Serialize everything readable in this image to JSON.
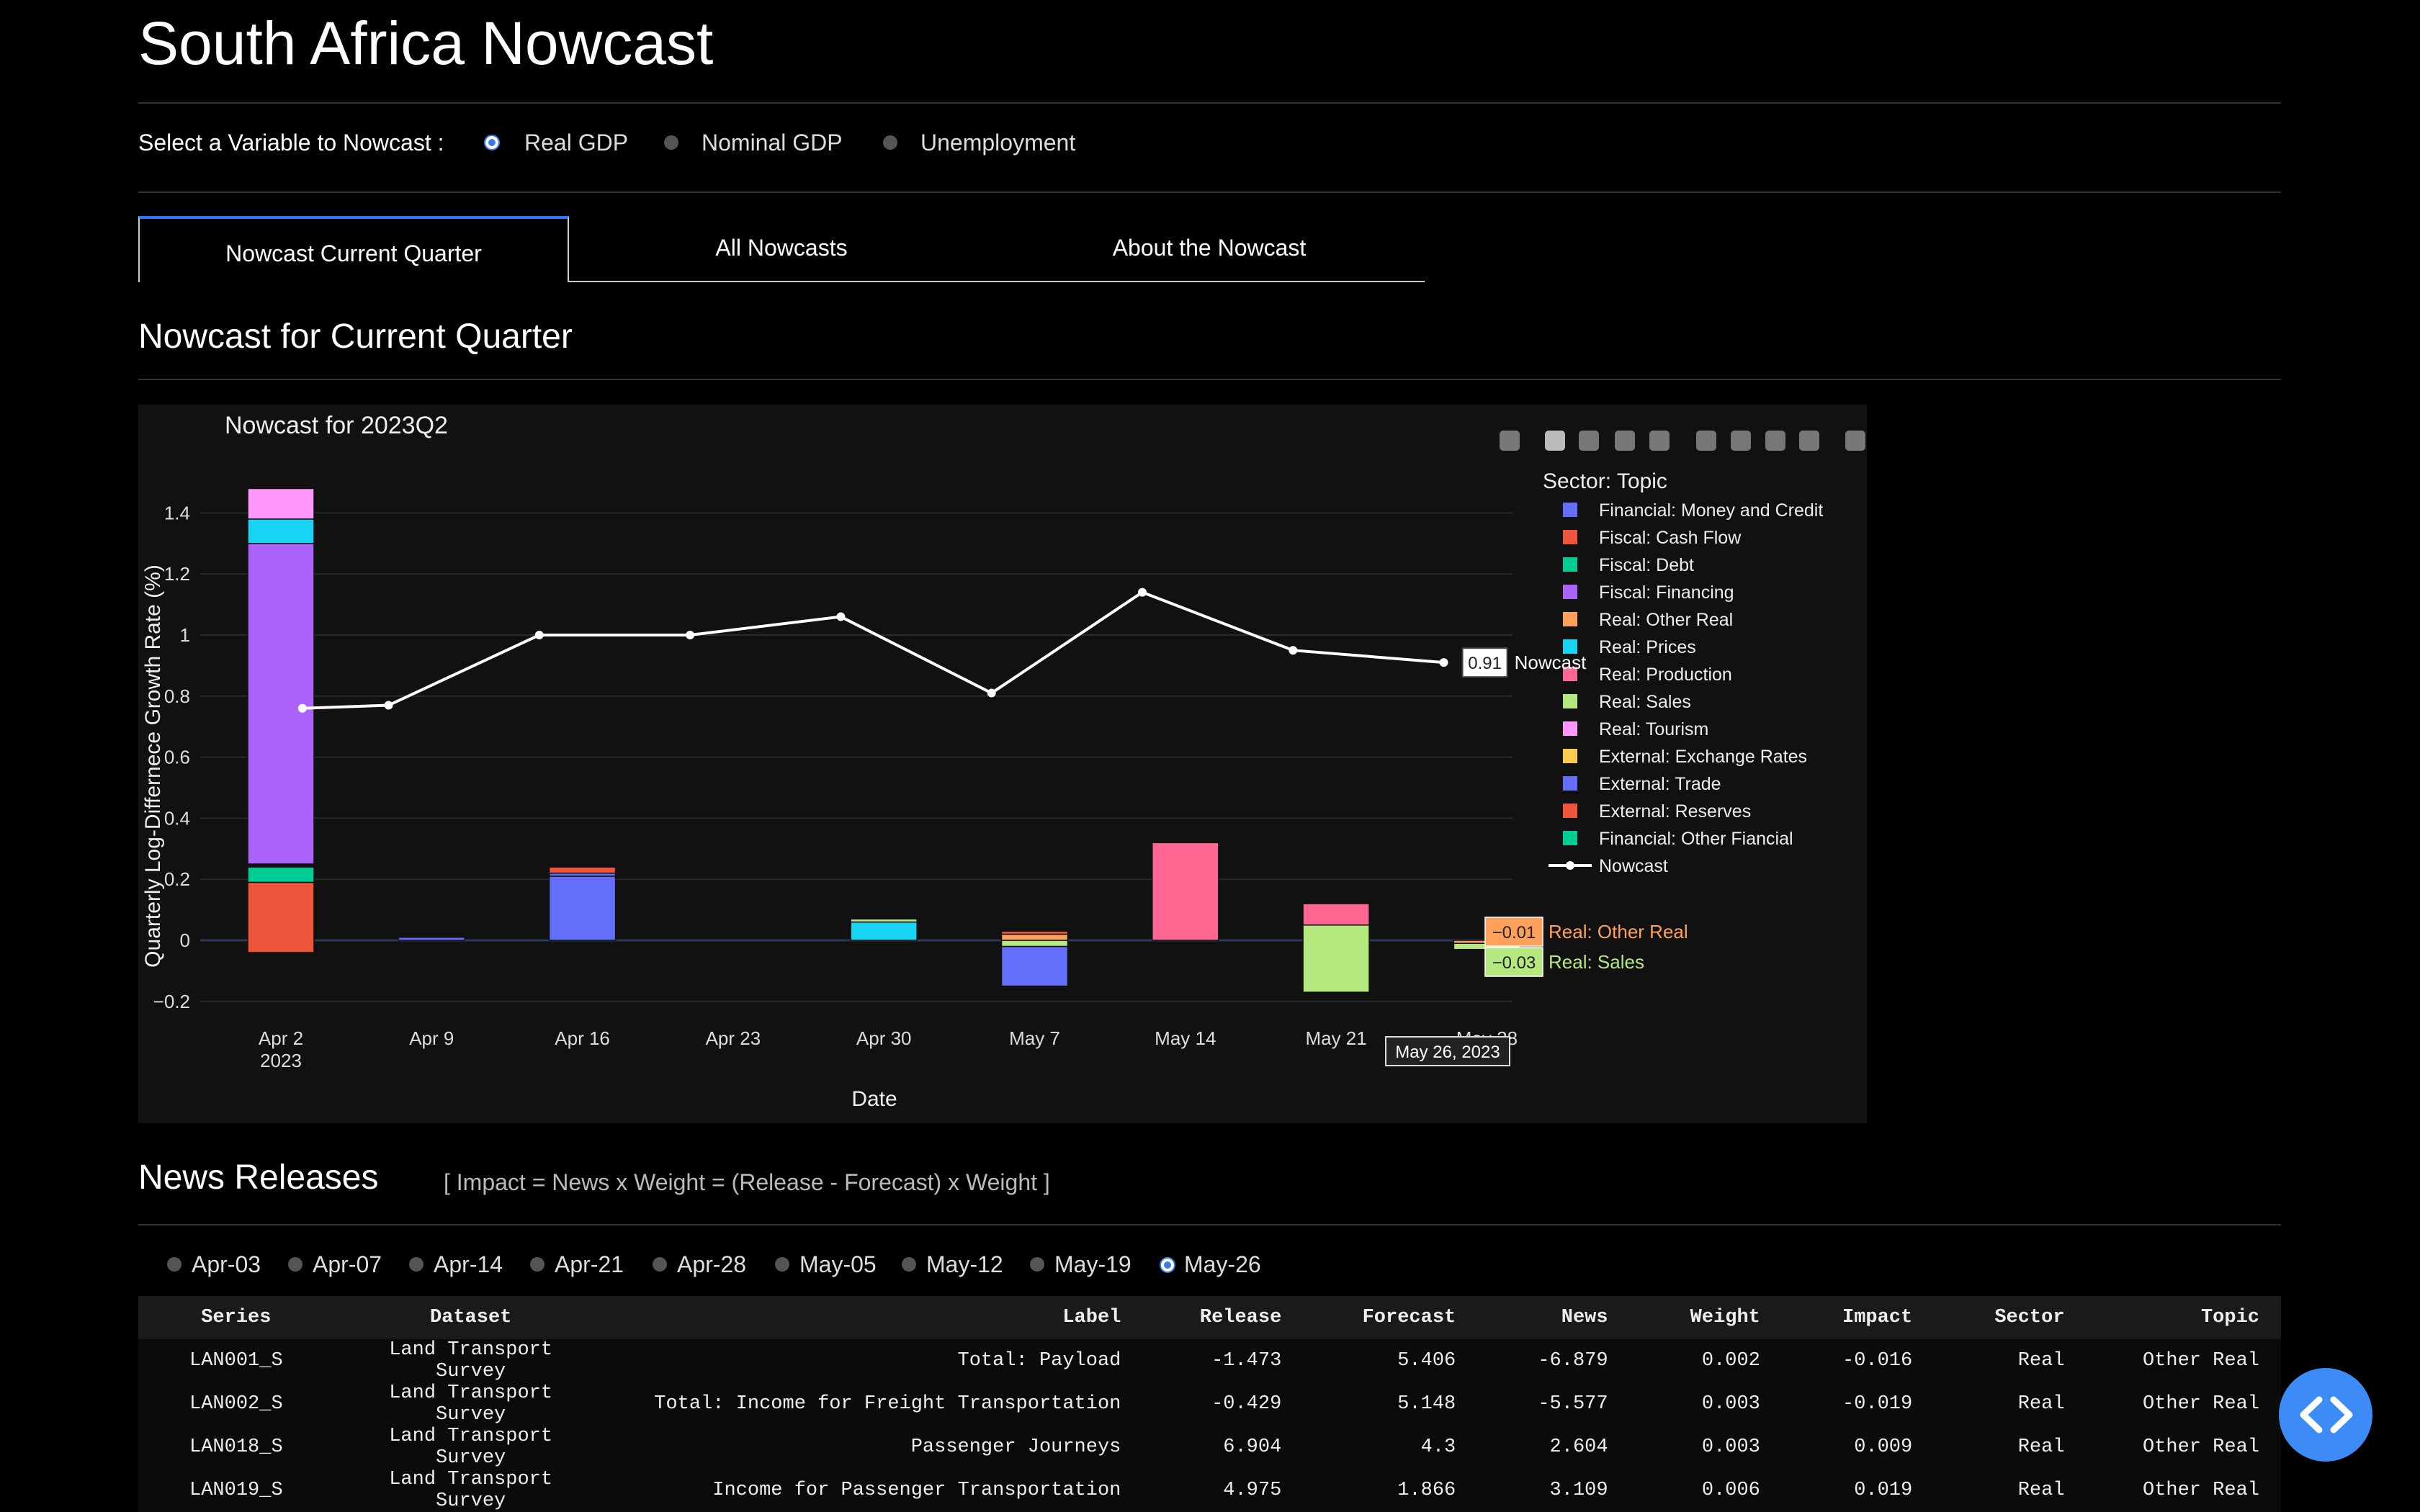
{
  "page_title": "South Africa Nowcast",
  "variable_label": "Select a Variable to Nowcast :",
  "variables": [
    "Real GDP",
    "Nominal GDP",
    "Unemployment"
  ],
  "tabs": [
    "Nowcast Current Quarter",
    "All Nowcasts",
    "About the Nowcast"
  ],
  "section_title": "Nowcast for Current Quarter",
  "chart_data": {
    "type": "bar",
    "title": "Nowcast for 2023Q2",
    "xlabel": "Date",
    "ylabel": "Quarterly Log-Differnece Growth Rate (%)",
    "ylim": [
      -0.27,
      1.52
    ],
    "yticks": [
      -0.2,
      0,
      0.2,
      0.4,
      0.6,
      0.8,
      1,
      1.2,
      1.4
    ],
    "ytick_labels": [
      "−0.2",
      "0",
      "0.2",
      "0.4",
      "0.6",
      "0.8",
      "1",
      "1.2",
      "1.4"
    ],
    "xtick_labels": [
      "Apr 2",
      "Apr 9",
      "Apr 16",
      "Apr 23",
      "Apr 30",
      "May 7",
      "May 14",
      "May 21",
      "May 28"
    ],
    "xtick_year": "2023",
    "legend_title": "Sector: Topic",
    "legend_position": "right",
    "series": [
      {
        "name": "Financial: Money and Credit",
        "color": "#636efa"
      },
      {
        "name": "Fiscal: Cash Flow",
        "color": "#ef553b"
      },
      {
        "name": "Fiscal: Debt",
        "color": "#00cc96"
      },
      {
        "name": "Fiscal: Financing",
        "color": "#ab63fa"
      },
      {
        "name": "Real: Other Real",
        "color": "#ffa15a"
      },
      {
        "name": "Real: Prices",
        "color": "#19d3f3"
      },
      {
        "name": "Real: Production",
        "color": "#ff6692"
      },
      {
        "name": "Real: Sales",
        "color": "#b6e880"
      },
      {
        "name": "Real: Tourism",
        "color": "#ff97ff"
      },
      {
        "name": "External: Exchange Rates",
        "color": "#fecb52"
      },
      {
        "name": "External: Trade",
        "color": "#636efa"
      },
      {
        "name": "External: Reserves",
        "color": "#ef553b"
      },
      {
        "name": "Financial: Other Fiancial",
        "color": "#00cc96"
      }
    ],
    "bars": [
      {
        "x": "2023-04-02",
        "segments": [
          {
            "series": "Fiscal: Cash Flow",
            "y0": -0.04,
            "y1": 0.19
          },
          {
            "series": "Fiscal: Debt",
            "y0": 0.19,
            "y1": 0.24
          },
          {
            "series": "Fiscal: Financing",
            "y0": 0.25,
            "y1": 1.3
          },
          {
            "series": "Real: Prices",
            "y0": 1.3,
            "y1": 1.38
          },
          {
            "series": "Real: Tourism",
            "y0": 1.38,
            "y1": 1.48
          }
        ]
      },
      {
        "x": "2023-04-09",
        "segments": [
          {
            "series": "External: Trade",
            "y0": 0,
            "y1": 0.01
          }
        ]
      },
      {
        "x": "2023-04-16",
        "segments": [
          {
            "series": "External: Trade",
            "y0": 0,
            "y1": 0.21
          },
          {
            "series": "Financial: Money and Credit",
            "y0": 0.21,
            "y1": 0.22
          },
          {
            "series": "Fiscal: Cash Flow",
            "y0": 0.22,
            "y1": 0.24
          }
        ]
      },
      {
        "x": "2023-04-30",
        "segments": [
          {
            "series": "Real: Prices",
            "y0": 0,
            "y1": 0.06
          },
          {
            "series": "Real: Sales",
            "y0": 0.06,
            "y1": 0.07
          }
        ]
      },
      {
        "x": "2023-05-07",
        "segments": [
          {
            "series": "External: Trade",
            "y0": -0.15,
            "y1": -0.02
          },
          {
            "series": "Real: Sales",
            "y0": -0.02,
            "y1": 0
          },
          {
            "series": "Real: Other Real",
            "y0": 0,
            "y1": 0.02
          },
          {
            "series": "External: Reserves",
            "y0": 0.02,
            "y1": 0.03
          }
        ]
      },
      {
        "x": "2023-05-14",
        "segments": [
          {
            "series": "Real: Production",
            "y0": 0,
            "y1": 0.32
          }
        ]
      },
      {
        "x": "2023-05-21",
        "segments": [
          {
            "series": "Real: Sales",
            "y0": -0.17,
            "y1": 0.05
          },
          {
            "series": "Real: Production",
            "y0": 0.05,
            "y1": 0.12
          }
        ]
      },
      {
        "x": "2023-05-28",
        "segments": [
          {
            "series": "Real: Sales",
            "y0": -0.03,
            "y1": -0.01
          },
          {
            "series": "Real: Other Real",
            "y0": -0.01,
            "y1": 0
          }
        ]
      }
    ],
    "nowcast": {
      "name": "Nowcast",
      "color": "#ffffff",
      "points": [
        {
          "x": "2023-04-03",
          "y": 0.76
        },
        {
          "x": "2023-04-07",
          "y": 0.77
        },
        {
          "x": "2023-04-14",
          "y": 1.0
        },
        {
          "x": "2023-04-21",
          "y": 1.0
        },
        {
          "x": "2023-04-28",
          "y": 1.06
        },
        {
          "x": "2023-05-05",
          "y": 0.81
        },
        {
          "x": "2023-05-12",
          "y": 1.14
        },
        {
          "x": "2023-05-19",
          "y": 0.95
        },
        {
          "x": "2023-05-26",
          "y": 0.91
        }
      ]
    },
    "hover": {
      "date_label": "May 26, 2023",
      "nowcast_value": "0.91",
      "nowcast_name": "Nowcast",
      "items": [
        {
          "value": "−0.01",
          "name": "Real: Other Real",
          "color": "#ffa15a"
        },
        {
          "value": "−0.03",
          "name": "Real: Sales",
          "color": "#b6e880"
        }
      ]
    }
  },
  "news": {
    "title": "News Releases",
    "formula": "[ Impact = News x Weight = (Release - Forecast) x Weight ]",
    "dates": [
      "Apr-03",
      "Apr-07",
      "Apr-14",
      "Apr-21",
      "Apr-28",
      "May-05",
      "May-12",
      "May-19",
      "May-26"
    ],
    "selected_date": "May-26",
    "columns": [
      "Series",
      "Dataset",
      "Label",
      "Release",
      "Forecast",
      "News",
      "Weight",
      "Impact",
      "Sector",
      "Topic"
    ],
    "rows": [
      [
        "LAN001_S",
        "Land Transport Survey",
        "Total: Payload",
        "-1.473",
        "5.406",
        "-6.879",
        "0.002",
        "-0.016",
        "Real",
        "Other Real"
      ],
      [
        "LAN002_S",
        "Land Transport Survey",
        "Total: Income for Freight Transportation",
        "-0.429",
        "5.148",
        "-5.577",
        "0.003",
        "-0.019",
        "Real",
        "Other Real"
      ],
      [
        "LAN018_S",
        "Land Transport Survey",
        "Passenger Journeys",
        "6.904",
        "4.3",
        "2.604",
        "0.003",
        "0.009",
        "Real",
        "Other Real"
      ],
      [
        "LAN019_S",
        "Land Transport Survey",
        "Income for Passenger Transportation",
        "4.975",
        "1.866",
        "3.109",
        "0.006",
        "0.019",
        "Real",
        "Other Real"
      ]
    ]
  },
  "modebar_icons": [
    "camera-icon",
    "zoom-icon",
    "pan-icon",
    "box-select-icon",
    "lasso-icon",
    "zoom-in-icon",
    "zoom-out-icon",
    "autoscale-icon",
    "reset-axes-icon",
    "plotly-logo-icon"
  ]
}
